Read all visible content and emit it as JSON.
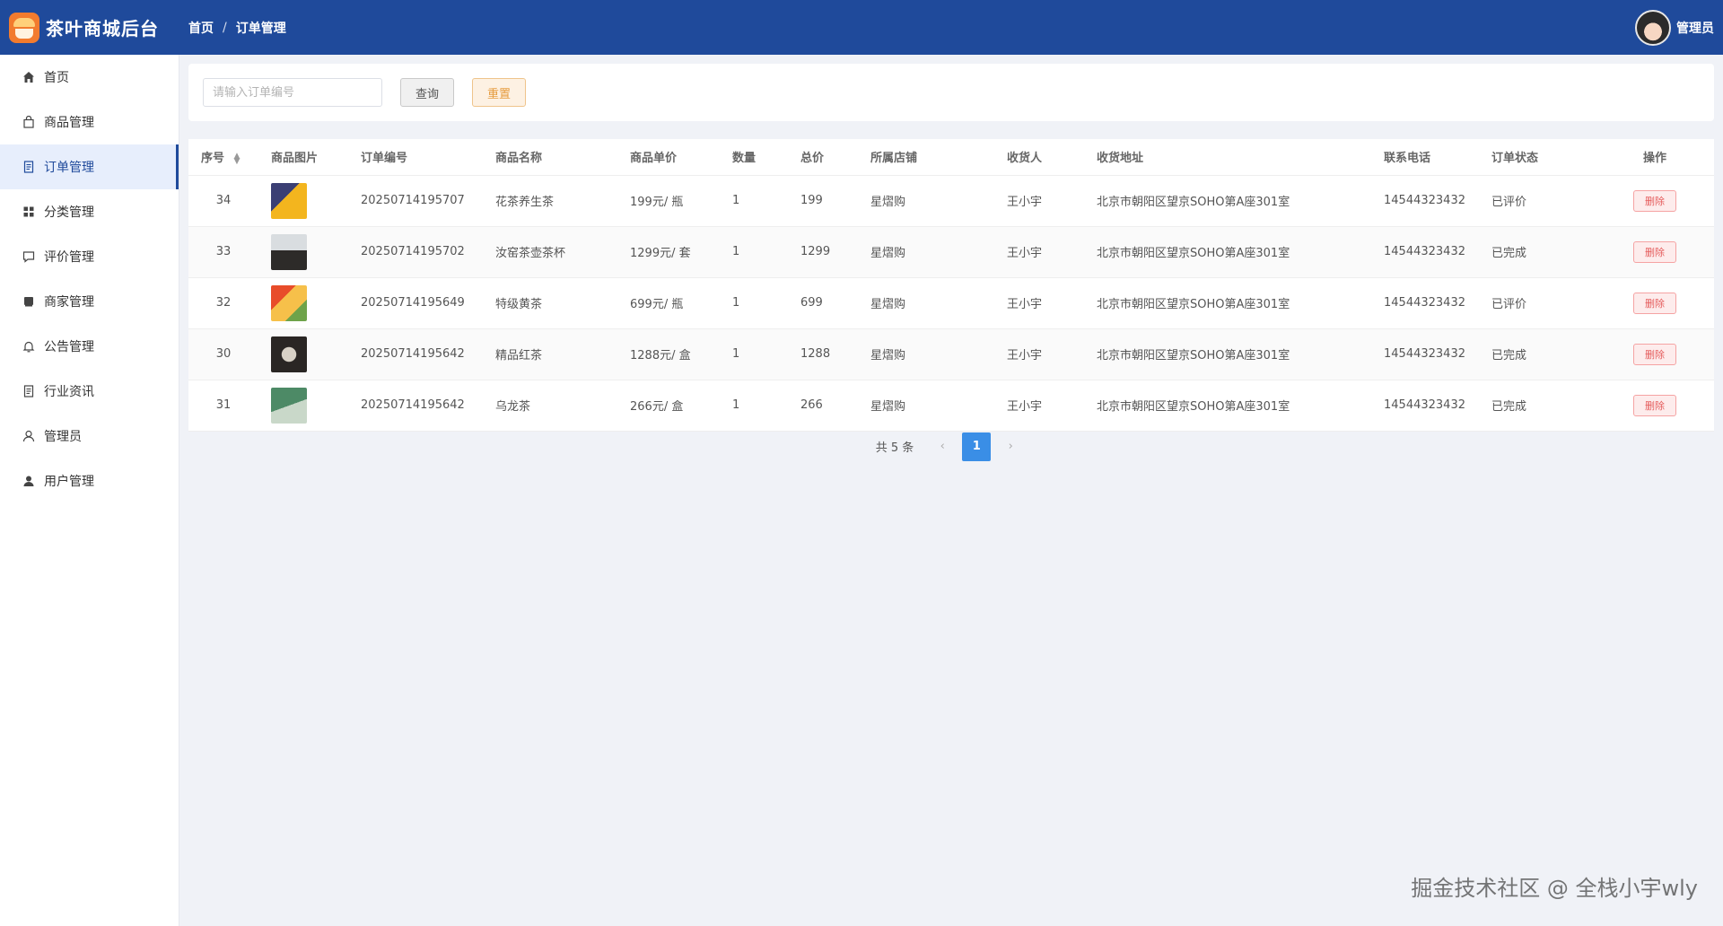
{
  "header": {
    "app_title": "茶叶商城后台",
    "breadcrumb": [
      "首页",
      "订单管理"
    ],
    "breadcrumb_sep": "/",
    "user_name": "管理员"
  },
  "sidebar": {
    "items": [
      {
        "label": "首页",
        "icon": "home-icon",
        "active": false
      },
      {
        "label": "商品管理",
        "icon": "shopping-bag-icon",
        "active": false
      },
      {
        "label": "订单管理",
        "icon": "document-icon",
        "active": true
      },
      {
        "label": "分类管理",
        "icon": "grid-icon",
        "active": false
      },
      {
        "label": "评价管理",
        "icon": "comment-icon",
        "active": false
      },
      {
        "label": "商家管理",
        "icon": "store-icon",
        "active": false
      },
      {
        "label": "公告管理",
        "icon": "bell-icon",
        "active": false
      },
      {
        "label": "行业资讯",
        "icon": "document-icon",
        "active": false
      },
      {
        "label": "管理员",
        "icon": "user-outline-icon",
        "active": false
      },
      {
        "label": "用户管理",
        "icon": "user-filled-icon",
        "active": false
      }
    ]
  },
  "search": {
    "placeholder": "请输入订单编号",
    "query_label": "查询",
    "reset_label": "重置"
  },
  "table": {
    "columns": [
      "序号",
      "商品图片",
      "订单编号",
      "商品名称",
      "商品单价",
      "数量",
      "总价",
      "所属店铺",
      "收货人",
      "收货地址",
      "联系电话",
      "订单状态",
      "操作"
    ],
    "rows": [
      {
        "id": "34",
        "thumb": "t1",
        "order_no": "20250714195707",
        "name": "花茶养生茶",
        "price": "199元/ 瓶",
        "qty": "1",
        "total": "199",
        "shop": "星熠购",
        "receiver": "王小宇",
        "address": "北京市朝阳区望京SOHO第A座301室",
        "phone": "14544323432",
        "status": "已评价",
        "action": "删除"
      },
      {
        "id": "33",
        "thumb": "t2",
        "order_no": "20250714195702",
        "name": "汝窑茶壶茶杯",
        "price": "1299元/ 套",
        "qty": "1",
        "total": "1299",
        "shop": "星熠购",
        "receiver": "王小宇",
        "address": "北京市朝阳区望京SOHO第A座301室",
        "phone": "14544323432",
        "status": "已完成",
        "action": "删除"
      },
      {
        "id": "32",
        "thumb": "t3",
        "order_no": "20250714195649",
        "name": "特级黄茶",
        "price": "699元/ 瓶",
        "qty": "1",
        "total": "699",
        "shop": "星熠购",
        "receiver": "王小宇",
        "address": "北京市朝阳区望京SOHO第A座301室",
        "phone": "14544323432",
        "status": "已评价",
        "action": "删除"
      },
      {
        "id": "30",
        "thumb": "t4",
        "order_no": "20250714195642",
        "name": "精品红茶",
        "price": "1288元/ 盒",
        "qty": "1",
        "total": "1288",
        "shop": "星熠购",
        "receiver": "王小宇",
        "address": "北京市朝阳区望京SOHO第A座301室",
        "phone": "14544323432",
        "status": "已完成",
        "action": "删除"
      },
      {
        "id": "31",
        "thumb": "t5",
        "order_no": "20250714195642",
        "name": "乌龙茶",
        "price": "266元/ 盒",
        "qty": "1",
        "total": "266",
        "shop": "星熠购",
        "receiver": "王小宇",
        "address": "北京市朝阳区望京SOHO第A座301室",
        "phone": "14544323432",
        "status": "已完成",
        "action": "删除"
      }
    ]
  },
  "pagination": {
    "total_text": "共 5 条",
    "prev": "‹",
    "current_page": "1",
    "next": "›"
  },
  "watermark": "掘金技术社区 @ 全栈小宇wly",
  "colors": {
    "header_bg": "#1f4a9b",
    "active_menu_bg": "#e7eefc",
    "page_active": "#3a8ee6",
    "delete_red": "#e55c5c",
    "reset_orange": "#e69c3f"
  }
}
